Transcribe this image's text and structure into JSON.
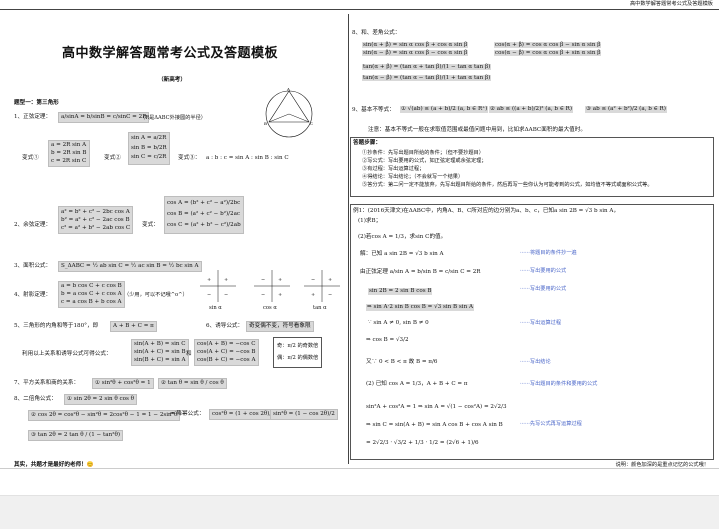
{
  "header": {
    "right_title": "高中数学解答题常考公式及答题模板"
  },
  "title": "高中数学解答题常考公式及答题模板",
  "subtitle": "（新高考）",
  "section1": {
    "label": "题型一：第三角形"
  },
  "left": {
    "l1": "1、正弦定理：",
    "l1_formula": "a/sinA = b/sinB = c/sinC = 2R",
    "l1_note": "（R是ΔABC外接圆的半径）",
    "v1_label": "变式①",
    "v1_lines": [
      "a = 2R sin A",
      "b = 2R sin B",
      "c = 2R sin C"
    ],
    "v2_label": "变式②",
    "v2_lines": [
      "sin A = a/2R",
      "sin B = b/2R",
      "sin C = c/2R"
    ],
    "v3_label": "变式③：",
    "v3_formula": "a : b : c = sin A : sin B : sin C",
    "l2": "2、余弦定理：",
    "l2_lines": [
      "a² = b² + c² − 2bc cos A",
      "b² = a² + c² − 2ac cos B",
      "c² = a² + b² − 2ab cos C"
    ],
    "l2_var_label": "变式：",
    "l2_var_lines": [
      "cos A = (b² + c² − a²)/2bc",
      "cos B = (a² + c² − b²)/2ac",
      "cos C = (a² + b² − c²)/2ab"
    ],
    "l3": "3、面积公式：",
    "l3_formula": "S_ΔABC = ½ ab sin C = ½ ac sin B = ½ bc sin A",
    "l4": "4、射影定理：",
    "l4_lines": [
      "a = b cos C + c cos B",
      "b = a cos C + c cos A",
      "c = a cos B + b cos A"
    ],
    "l4_note": "（少用，可以不记哦^o^）",
    "graph_labels": [
      "sin α",
      "cos α",
      "tan α"
    ],
    "l5": "5、三角形的内角和等于180°，即",
    "l5_formula": "A + B + C = π",
    "l6": "6、诱导公式：",
    "l6_formula": "奇变偶不变，符号看象限",
    "l7_intro": "利用以上关系和诱导公式可得公式：",
    "l7_a": [
      "sin(A + B) = sin C",
      "sin(A + C) = sin B",
      "sin(B + C) = sin A"
    ],
    "l7_and": "和",
    "l7_b": [
      "cos(A + B) = −cos C",
      "cos(A + C) = −cos B",
      "cos(B + C) = −cos A"
    ],
    "l7_note_odd": "奇：π/2 的奇数倍",
    "l7_note_even": "偶：π/2 的偶数倍",
    "l8": "7、平方关系和商的关系：",
    "l8_a": "① sin²θ + cos²θ = 1",
    "l8_b": "② tan θ = sin θ / cos θ",
    "l9": "8、二倍角公式：",
    "l9_a": "① sin 2θ = 2 sin θ cos θ",
    "l9_b": "② cos 2θ = cos²θ − sin²θ = 2cos²θ − 1 = 1 − 2sin²θ",
    "l9_arrow": "⇒ 降幂公式：",
    "l9_c": "cos²θ = (1 + cos 2θ)/2",
    "l9_d": "sin²θ = (1 − cos 2θ)/2",
    "l9_e": "③ tan 2θ = 2 tan θ / (1 − tan²θ)",
    "footer_left": "其实，共题才是最好的老师！😊"
  },
  "right": {
    "r8": "8、和、差角公式：",
    "r8_a": [
      "sin(α + β) = sin α cos β + cos α sin β",
      "sin(α − β) = sin α cos β − cos α sin β"
    ],
    "r8_b": [
      "cos(α + β) = cos α cos β − sin α sin β",
      "cos(α − β) = cos α cos β + sin α sin β"
    ],
    "r8_c": [
      "tan(α + β) = (tan α + tan β)/(1 − tan α tan β)",
      "tan(α − β) = (tan α − tan β)/(1 + tan α tan β)"
    ],
    "r9": "9、基本不等式：",
    "r9_a": "① √(ab) ≤ (a + b)/2   (a, b ∈ R⁺)",
    "r9_b": "② ab ≤ ((a + b)/2)²   (a, b ∈ R)",
    "r9_c": "③ ab ≤ (a² + b²)/2   (a, b ∈ R)",
    "r9_note": "注意：基本不等式一般在求取值范围或最值问题中用到，比如求ΔABC面积的最大值时。",
    "tpl_title": "答题步骤：",
    "tpl_steps": [
      "①抄条件：先写出题目所给的条件；（但不要抄题目）",
      "②写公式：写出要用的公式，如正弦定理或余弦定理；",
      "③有过程：写出运算过程；",
      "④得结论：写出结论；（不会就写一个结果）",
      "⑤答分式：第二问一定不能放弃，先写出题目所给的条件，然后再写一些你认为可能考到的公式，如均值不等式或面积公式等。"
    ],
    "ex_title": "例1：(2016天津文)在ΔABC中，内角A、B、C所对应的边分别为a、b、c，已知a sin 2B = √3 b sin A，",
    "ex_q1": "(1)求B；",
    "ex_q2": "(2)若cos A = 1/3，求sin C的值。",
    "sol": [
      "解：已知 a sin 2B = √3 b sin A",
      "由正弦定理 a/sin A = b/sin B = c/sin C = 2R",
      "sin 2B = 2 sin B cos B",
      "⇒ sin A·2 sin B cos B = √3 sin B sin A",
      "∵ sin A ≠ 0, sin B ≠ 0",
      "⇒ cos B = √3/2",
      "又∵ 0 < B < π   故 B = π/6",
      "(2) 已知 cos A = 1/3，A + B + C = π",
      "sin²A + cos²A = 1 ⇒ sin A = √(1 − cos²A) = 2√2/3",
      "⇒ sin C = sin(A + B) = sin A cos B + cos A sin B",
      "= 2√2/3 · √3/2 + 1/3 · 1/2 = (2√6 + 1)/6"
    ],
    "notes": [
      "······将题目的条件抄一遍",
      "······写出要用的公式",
      "······写出要用的公式",
      "······写出运算过程",
      "······写出结论",
      "······写出题目的条件和要用的公式",
      "······先写公式再写运算过程"
    ],
    "footer_right": "说明：颜色加深的是重点记忆的公式哦！"
  },
  "colors": {
    "highlight": "#d9d9d9",
    "note_blue": "#4a66c9",
    "line": "#444444"
  }
}
